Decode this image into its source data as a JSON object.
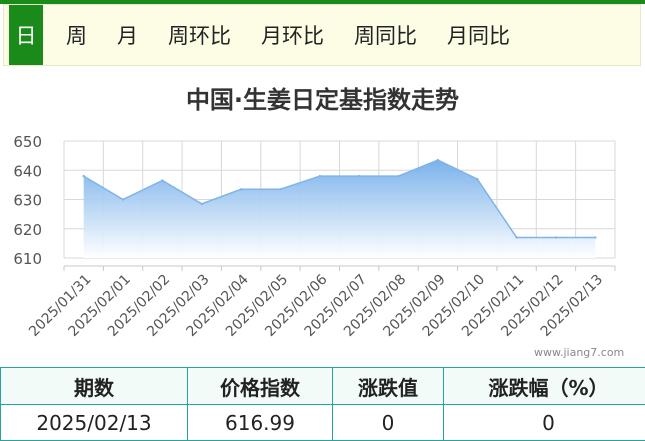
{
  "tabs": [
    "日",
    "周",
    "月",
    "周环比",
    "月环比",
    "周同比",
    "月同比"
  ],
  "active_tab": "日",
  "colors": {
    "brand": "#1a8a1a",
    "area_top": "#74aeea",
    "line": "#7eb4e8",
    "table_border": "#26a69a"
  },
  "watermark": "www.jiang7.com",
  "chart_data": {
    "type": "area",
    "title": "中国·生姜日定基指数走势",
    "xlabel": "",
    "ylabel": "",
    "x": [
      "2025/01/31",
      "2025/02/01",
      "2025/02/02",
      "2025/02/03",
      "2025/02/04",
      "2025/02/05",
      "2025/02/06",
      "2025/02/07",
      "2025/02/08",
      "2025/02/09",
      "2025/02/10",
      "2025/02/11",
      "2025/02/12",
      "2025/02/13"
    ],
    "values": [
      638,
      630,
      636.5,
      628.5,
      633.5,
      633.5,
      638,
      638,
      638,
      643.5,
      637,
      617,
      617,
      616.99
    ],
    "yticks": [
      650,
      640,
      630,
      620,
      610
    ],
    "ylim": [
      610,
      650
    ],
    "grid": true
  },
  "table": {
    "headers": [
      "期数",
      "价格指数",
      "涨跌值",
      "涨跌幅（%）"
    ],
    "rows": [
      [
        "2025/02/13",
        "616.99",
        "0",
        "0"
      ]
    ]
  }
}
